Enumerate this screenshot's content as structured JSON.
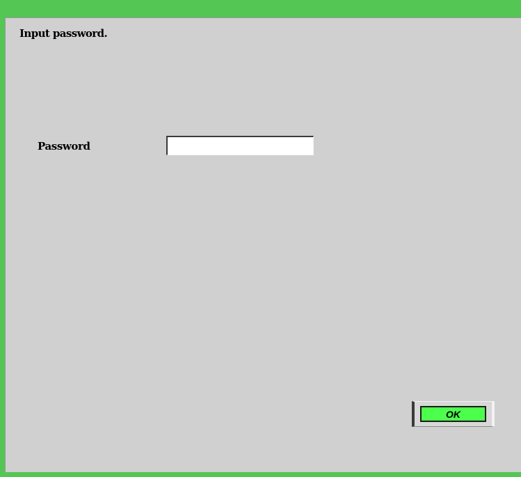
{
  "dialog": {
    "prompt": "Input password.",
    "password_label": "Password",
    "password_value": "",
    "password_placeholder": "",
    "ok_label": "OK"
  },
  "colors": {
    "frame": "#53c653",
    "panel": "#d0d0d0",
    "ok_button_face": "#4dff4d"
  }
}
